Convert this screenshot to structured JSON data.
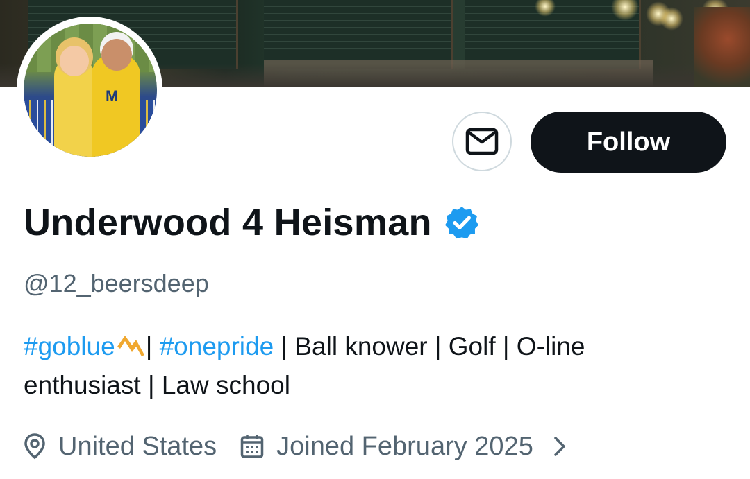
{
  "profile": {
    "display_name": "Underwood 4 Heisman",
    "handle": "@12_beersdeep",
    "verified": true,
    "bio": {
      "tag1": "#goblue",
      "sep1": "| ",
      "tag2": "#onepride",
      "rest_line1": " | Ball knower | Golf | O-line",
      "rest_line2": "enthusiast | Law school"
    },
    "location": "United States",
    "joined": "Joined February 2025"
  },
  "actions": {
    "follow_label": "Follow"
  },
  "colors": {
    "accent": "#1d9bf0",
    "text": "#0f1419",
    "muted": "#536471",
    "button_bg": "#0f1419",
    "emoji_lightning": "#f0a830"
  },
  "icons": {
    "message": "envelope-icon",
    "verified": "verified-badge-icon",
    "location": "location-pin-icon",
    "joined": "calendar-icon",
    "more": "chevron-right-icon"
  }
}
